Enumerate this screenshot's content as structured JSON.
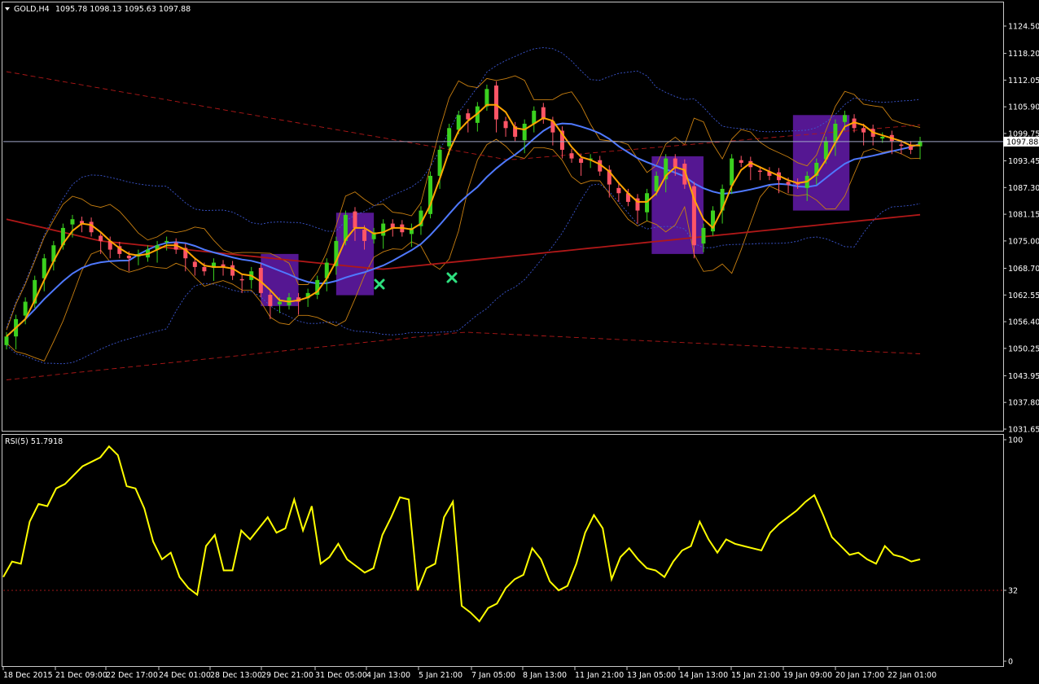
{
  "header": {
    "symbol": "GOLD,H4",
    "ohlc": "1095.78 1098.13 1095.63 1097.88"
  },
  "rsi_header": "RSI(5) 51.7918",
  "current_price_label": "1097.88",
  "colors": {
    "background": "#000000",
    "frame": "#c8c8c8",
    "bull": "#3bd11f",
    "bear": "#ff5566",
    "ma_fast": "#ffa500",
    "ma_mid": "#4f79ff",
    "ma_slow": "#b01818",
    "bb_inner": "#c87f10",
    "bb_outer": "#3b56d0",
    "rsi_line": "#ffff00",
    "zone": "#5a189a",
    "marker": "#2ee07f"
  },
  "chart_data": [
    {
      "type": "candlestick",
      "title": "GOLD,H4",
      "ylim": [
        1031.65,
        1127.6
      ],
      "yticks": [
        "1124.50",
        "1118.20",
        "1112.05",
        "1105.90",
        "1099.75",
        "1093.45",
        "1087.30",
        "1081.15",
        "1075.00",
        "1068.70",
        "1062.55",
        "1056.40",
        "1050.25",
        "1043.95",
        "1037.80",
        "1031.65"
      ],
      "xticks": [
        "18 Dec 2015",
        "21 Dec 09:00",
        "22 Dec 17:00",
        "24 Dec 01:00",
        "28 Dec 13:00",
        "29 Dec 21:00",
        "31 Dec 05:00",
        "4 Jan 13:00",
        "5 Jan 21:00",
        "7 Jan 05:00",
        "8 Jan 13:00",
        "11 Jan 21:00",
        "13 Jan 05:00",
        "14 Jan 13:00",
        "15 Jan 21:00",
        "19 Jan 09:00",
        "20 Jan 17:00",
        "22 Jan 01:00"
      ],
      "close_path": [
        1053,
        1057,
        1061,
        1066,
        1071,
        1074,
        1078,
        1080,
        1079,
        1077,
        1075,
        1073,
        1072,
        1071,
        1072,
        1073,
        1074,
        1075,
        1073,
        1071,
        1069,
        1068,
        1070,
        1069,
        1067,
        1066,
        1068,
        1063,
        1060,
        1061,
        1062,
        1061,
        1063,
        1066,
        1070,
        1075,
        1081,
        1078,
        1075,
        1077,
        1079,
        1078,
        1077,
        1078,
        1082,
        1090,
        1096,
        1101,
        1104,
        1103,
        1106,
        1110,
        1103,
        1101,
        1099,
        1102,
        1105,
        1103,
        1100,
        1096,
        1094,
        1093,
        1094,
        1091,
        1088,
        1086,
        1084,
        1082,
        1086,
        1090,
        1094,
        1092,
        1088,
        1074,
        1078,
        1082,
        1087,
        1094,
        1093,
        1092,
        1091,
        1090,
        1089,
        1088,
        1088,
        1090,
        1093,
        1098,
        1102,
        1104,
        1101,
        1100,
        1099,
        1099,
        1098,
        1097,
        1096,
        1098
      ]
    },
    {
      "type": "line",
      "title": "RSI(5) 51.7918",
      "ylim": [
        0,
        100
      ],
      "yticks": [
        "100",
        "32",
        "0"
      ],
      "level": 32,
      "series": [
        {
          "name": "RSI(5)",
          "values": [
            38,
            45,
            44,
            63,
            71,
            70,
            78,
            80,
            84,
            88,
            90,
            92,
            97,
            93,
            79,
            78,
            69,
            54,
            46,
            49,
            38,
            33,
            30,
            52,
            57,
            41,
            41,
            59,
            55,
            60,
            65,
            58,
            60,
            73,
            59,
            70,
            44,
            47,
            53,
            46,
            43,
            40,
            42,
            57,
            65,
            74,
            73,
            32,
            42,
            44,
            65,
            72,
            25,
            22,
            18,
            24,
            26,
            33,
            37,
            39,
            51,
            46,
            36,
            32,
            34,
            44,
            58,
            66,
            60,
            37,
            47,
            51,
            46,
            42,
            41,
            38,
            45,
            50,
            52,
            63,
            55,
            49,
            55,
            53,
            52,
            51,
            50,
            58,
            62,
            65,
            68,
            72,
            75,
            66,
            56,
            52,
            48,
            49,
            46,
            44,
            52,
            48,
            47,
            45,
            46
          ]
        }
      ]
    }
  ]
}
